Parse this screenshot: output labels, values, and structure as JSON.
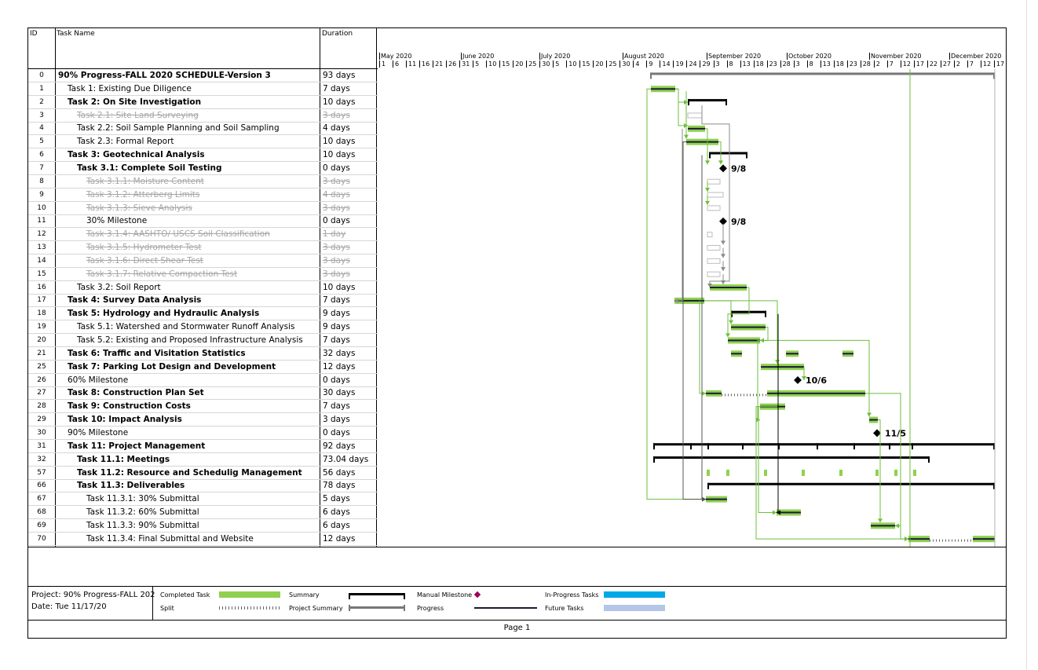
{
  "headers": {
    "id": "ID",
    "name": "Task Name",
    "duration": "Duration"
  },
  "timescale": {
    "months": [
      "May 2020",
      "June 2020",
      "July 2020",
      "August 2020",
      "September 2020",
      "October 2020",
      "November 2020",
      "December 2020"
    ],
    "days": [
      "1",
      "6",
      "11",
      "16",
      "21",
      "26",
      "31",
      "5",
      "10",
      "15",
      "20",
      "25",
      "30",
      "5",
      "10",
      "15",
      "20",
      "25",
      "30",
      "4",
      "9",
      "14",
      "19",
      "24",
      "29",
      "3",
      "8",
      "13",
      "18",
      "23",
      "28",
      "3",
      "8",
      "13",
      "18",
      "23",
      "28",
      "2",
      "7",
      "12",
      "17",
      "22",
      "27",
      "2",
      "7",
      "12",
      "17"
    ]
  },
  "tasks": [
    {
      "id": "0",
      "name": "90% Progress-FALL 2020 SCHEDULE-Version 3",
      "duration": "93 days",
      "style": "bold",
      "level": 0
    },
    {
      "id": "1",
      "name": "Task 1: Existing Due Diligence",
      "duration": "7 days",
      "style": "normal",
      "level": 1
    },
    {
      "id": "2",
      "name": "Task 2: On Site Investigation",
      "duration": "10 days",
      "style": "bold",
      "level": 1
    },
    {
      "id": "3",
      "name": "Task 2.1: Site Land Surveying",
      "duration": "3 days",
      "style": "inactive",
      "level": 2
    },
    {
      "id": "4",
      "name": "Task 2.2: Soil Sample Planning and Soil Sampling",
      "duration": "4 days",
      "style": "normal",
      "level": 2
    },
    {
      "id": "5",
      "name": "Task 2.3: Formal Report",
      "duration": "10 days",
      "style": "normal",
      "level": 2
    },
    {
      "id": "6",
      "name": "Task 3: Geotechnical Analysis",
      "duration": "10 days",
      "style": "bold",
      "level": 1
    },
    {
      "id": "7",
      "name": "Task 3.1: Complete Soil Testing",
      "duration": "0 days",
      "style": "bold",
      "level": 2
    },
    {
      "id": "8",
      "name": "Task 3.1.1: Moisture Content",
      "duration": "3 days",
      "style": "inactive",
      "level": 3
    },
    {
      "id": "9",
      "name": "Task 3.1.2: Atterberg Limits",
      "duration": "4 days",
      "style": "inactive",
      "level": 3
    },
    {
      "id": "10",
      "name": "Task 3.1.3: Sieve Analysis",
      "duration": "3 days",
      "style": "inactive",
      "level": 3
    },
    {
      "id": "11",
      "name": "30% Milestone",
      "duration": "0 days",
      "style": "normal",
      "level": 3
    },
    {
      "id": "12",
      "name": "Task 3.1.4: AASHTO/ USCS Soil Classification",
      "duration": "1 day",
      "style": "inactive",
      "level": 3
    },
    {
      "id": "13",
      "name": "Task 3.1.5: Hydrometer Test",
      "duration": "3 days",
      "style": "inactive",
      "level": 3
    },
    {
      "id": "14",
      "name": "Task 3.1.6: Direct Shear Test",
      "duration": "3 days",
      "style": "inactive",
      "level": 3
    },
    {
      "id": "15",
      "name": "Task 3.1.7: Relative Compaction Test",
      "duration": "3 days",
      "style": "inactive",
      "level": 3
    },
    {
      "id": "16",
      "name": "Task 3.2: Soil Report",
      "duration": "10 days",
      "style": "normal",
      "level": 2
    },
    {
      "id": "17",
      "name": "Task 4: Survey Data Analysis",
      "duration": "7 days",
      "style": "bold",
      "level": 1
    },
    {
      "id": "18",
      "name": "Task 5: Hydrology and Hydraulic Analysis",
      "duration": "9 days",
      "style": "bold",
      "level": 1
    },
    {
      "id": "19",
      "name": "Task 5.1: Watershed  and Stormwater Runoff Analysis",
      "duration": "9 days",
      "style": "normal",
      "level": 2
    },
    {
      "id": "20",
      "name": "Task 5.2: Existing and Proposed Infrastructure Analysis",
      "duration": "7 days",
      "style": "normal",
      "level": 2
    },
    {
      "id": "21",
      "name": "Task 6: Traffic and Visitation Statistics",
      "duration": "32 days",
      "style": "bold",
      "level": 1
    },
    {
      "id": "25",
      "name": "Task 7: Parking Lot Design and Development",
      "duration": "12 days",
      "style": "bold",
      "level": 1
    },
    {
      "id": "26",
      "name": "60% Milestone",
      "duration": "0 days",
      "style": "normal",
      "level": 1
    },
    {
      "id": "27",
      "name": "Task 8: Construction Plan Set",
      "duration": "30 days",
      "style": "bold",
      "level": 1
    },
    {
      "id": "28",
      "name": "Task 9: Construction Costs",
      "duration": "7 days",
      "style": "bold",
      "level": 1
    },
    {
      "id": "29",
      "name": "Task 10: Impact Analysis",
      "duration": "3 days",
      "style": "bold",
      "level": 1
    },
    {
      "id": "30",
      "name": "90% Milestone",
      "duration": "0 days",
      "style": "normal",
      "level": 1
    },
    {
      "id": "31",
      "name": "Task 11: Project Management",
      "duration": "92 days",
      "style": "bold",
      "level": 1
    },
    {
      "id": "32",
      "name": "Task 11.1: Meetings",
      "duration": "73.04 days",
      "style": "bold",
      "level": 2
    },
    {
      "id": "57",
      "name": "Task 11.2: Resource and Schedulig Management",
      "duration": "56 days",
      "style": "bold",
      "level": 2
    },
    {
      "id": "66",
      "name": "Task 11.3: Deliverables",
      "duration": "78 days",
      "style": "bold",
      "level": 2
    },
    {
      "id": "67",
      "name": "Task 11.3.1: 30% Submittal",
      "duration": "5 days",
      "style": "normal",
      "level": 3
    },
    {
      "id": "68",
      "name": "Task 11.3.2: 60% Submittal",
      "duration": "6 days",
      "style": "normal",
      "level": 3
    },
    {
      "id": "69",
      "name": "Task 11.3.3: 90% Submittal",
      "duration": "6 days",
      "style": "normal",
      "level": 3
    },
    {
      "id": "70",
      "name": "Task 11.3.4: Final Submittal and Website",
      "duration": "12 days",
      "style": "normal",
      "level": 3
    }
  ],
  "milestone_labels": [
    "9/8",
    "9/8",
    "10/6",
    "11/5"
  ],
  "project_info": {
    "project": "Project: 90% Progress-FALL 202",
    "date": "Date: Tue 11/17/20"
  },
  "legend": {
    "completed_task": "Completed Task",
    "split": "Split",
    "summary": "Summary",
    "project_summary": "Project Summary",
    "manual_milestone": "Manual Milestone",
    "progress": "Progress",
    "in_progress": "In-Progress Tasks",
    "future": "Future Tasks"
  },
  "colors": {
    "completed": "#8fd14f",
    "in_progress": "#00a8e8",
    "future": "#b4c6e7",
    "milestone_legend": "#a0005a",
    "link": "#6cbf3c",
    "link_gray": "#8a8a8a"
  },
  "page": "Page 1"
}
